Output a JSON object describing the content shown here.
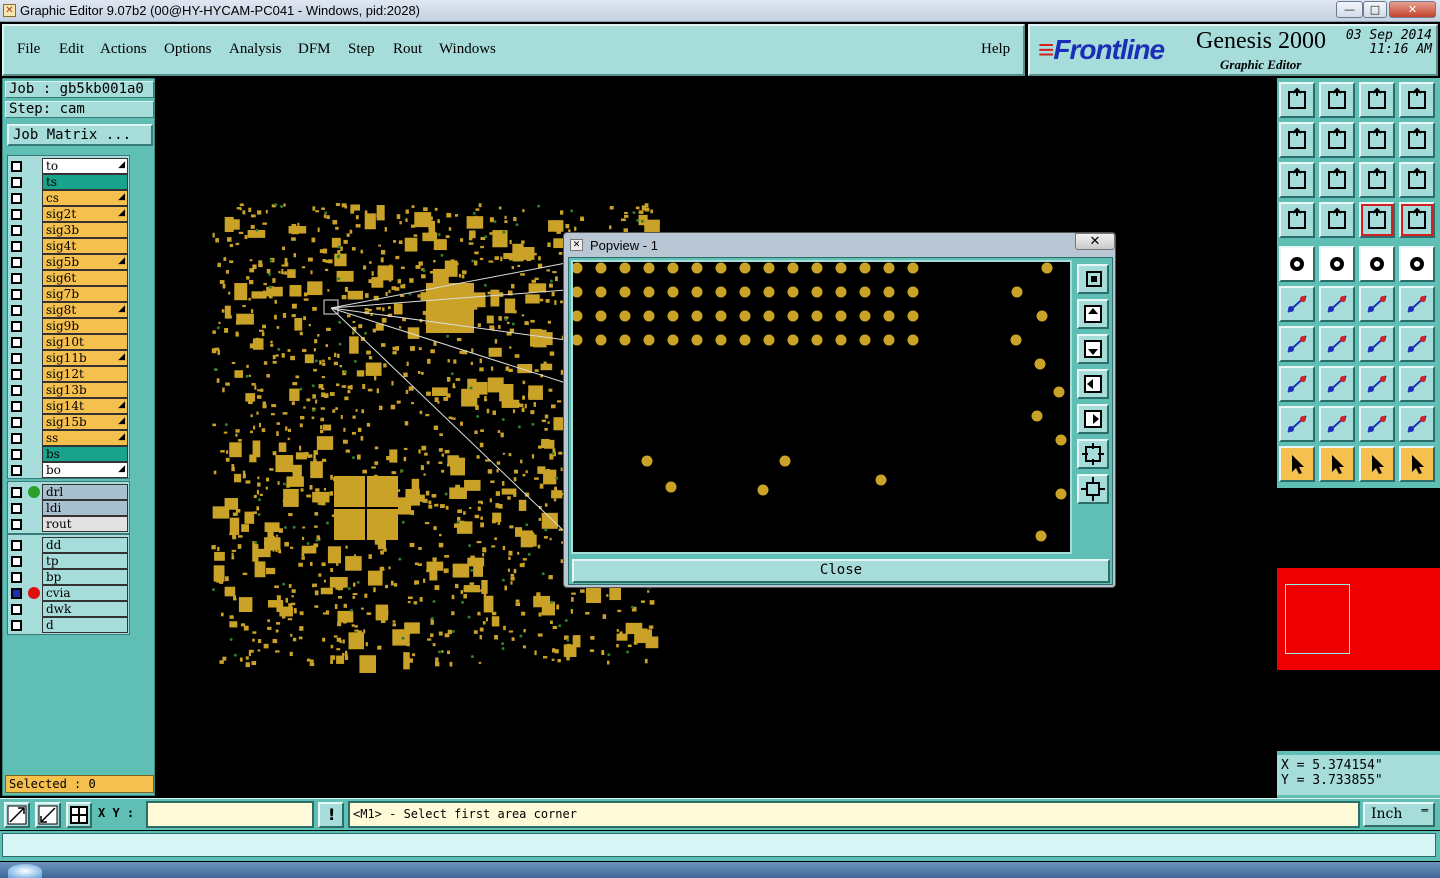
{
  "window": {
    "title": "Graphic Editor 9.07b2 (00@HY-HYCAM-PC041 - Windows, pid:2028)",
    "min": "—",
    "max": "□",
    "close": "✕"
  },
  "menu": {
    "file": "File",
    "edit": "Edit",
    "actions": "Actions",
    "options": "Options",
    "analysis": "Analysis",
    "dfm": "DFM",
    "step": "Step",
    "rout": "Rout",
    "windows": "Windows",
    "help": "Help"
  },
  "brand": {
    "logo": "Frontline",
    "product": "Genesis 2000",
    "subtitle": "Graphic Editor",
    "date": "03 Sep 2014",
    "time": "11:16 AM"
  },
  "job": {
    "job": "Job : gb5kb001a0",
    "step": "Step: cam",
    "matrix": "Job Matrix ..."
  },
  "layers_main": [
    {
      "name": "to",
      "bg": "#ffffff",
      "mark": "◢"
    },
    {
      "name": "ts",
      "bg": "#1aa38c",
      "mark": ""
    },
    {
      "name": "cs",
      "bg": "#f5c04e",
      "mark": "◢"
    },
    {
      "name": "sig2t",
      "bg": "#f5c04e",
      "mark": "◢"
    },
    {
      "name": "sig3b",
      "bg": "#f5c04e",
      "mark": ""
    },
    {
      "name": "sig4t",
      "bg": "#f5c04e",
      "mark": ""
    },
    {
      "name": "sig5b",
      "bg": "#f5c04e",
      "mark": "◢"
    },
    {
      "name": "sig6t",
      "bg": "#f5c04e",
      "mark": ""
    },
    {
      "name": "sig7b",
      "bg": "#f5c04e",
      "mark": ""
    },
    {
      "name": "sig8t",
      "bg": "#f5c04e",
      "mark": "◢"
    },
    {
      "name": "sig9b",
      "bg": "#f5c04e",
      "mark": ""
    },
    {
      "name": "sig10t",
      "bg": "#f5c04e",
      "mark": ""
    },
    {
      "name": "sig11b",
      "bg": "#f5c04e",
      "mark": "◢"
    },
    {
      "name": "sig12t",
      "bg": "#f5c04e",
      "mark": ""
    },
    {
      "name": "sig13b",
      "bg": "#f5c04e",
      "mark": ""
    },
    {
      "name": "sig14t",
      "bg": "#f5c04e",
      "mark": "◢"
    },
    {
      "name": "sig15b",
      "bg": "#f5c04e",
      "mark": "◢"
    },
    {
      "name": "ss",
      "bg": "#f5c04e",
      "mark": "◢"
    },
    {
      "name": "bs",
      "bg": "#1aa38c",
      "mark": ""
    },
    {
      "name": "bo",
      "bg": "#ffffff",
      "mark": "◢"
    }
  ],
  "layers_drill": [
    {
      "name": "drl",
      "bg": "#a9c0cf",
      "dot": "#2aa02a"
    },
    {
      "name": "ldi",
      "bg": "#a9c0cf",
      "dot": ""
    },
    {
      "name": "rout",
      "bg": "#e2e2e2",
      "dot": ""
    }
  ],
  "layers_misc": [
    {
      "name": "dd",
      "bg": "#a6dcd9",
      "dot": "",
      "on": false
    },
    {
      "name": "tp",
      "bg": "#a6dcd9",
      "dot": "",
      "on": false
    },
    {
      "name": "bp",
      "bg": "#a6dcd9",
      "dot": "",
      "on": false
    },
    {
      "name": "cvia",
      "bg": "#a6dcd9",
      "dot": "#e01010",
      "on": true
    },
    {
      "name": "dwk",
      "bg": "#a6dcd9",
      "dot": "",
      "on": false
    },
    {
      "name": "d",
      "bg": "#a6dcd9",
      "dot": "",
      "on": false
    }
  ],
  "selected": "Selected : 0",
  "coords": {
    "x": "X = 5.374154\"",
    "y": "Y = 3.733855\""
  },
  "bottom": {
    "xy_label": "X Y :",
    "xy_value": "",
    "message": "<M1> - Select first area corner",
    "unit": "Inch",
    "exclaim": "!"
  },
  "popup": {
    "title": "Popview - 1",
    "close_x": "✕",
    "close": "Close"
  },
  "colors": {
    "panel": "#5fbfb5",
    "panel_light": "#a6dcd9",
    "copper": "#c9a227",
    "warn": "#f5c04e"
  }
}
